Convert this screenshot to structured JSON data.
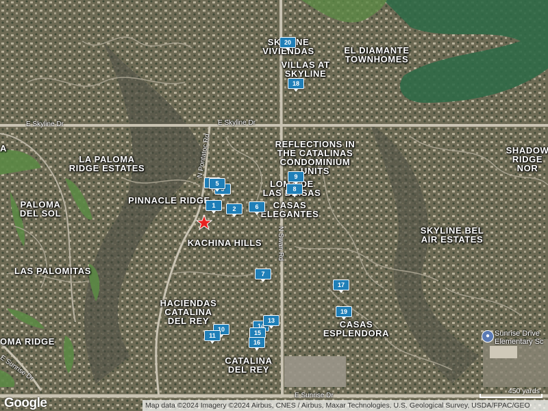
{
  "colors": {
    "terrain": "#6d6b55",
    "terrain_dark": "#4b4a3c",
    "golf_green": "#2f6a47",
    "grass": "#5b8a45",
    "road_major": "#c9c3b3",
    "marker_blue": "#1f7fb8",
    "star_red": "#e8201f"
  },
  "neighborhoods": [
    {
      "id": "skyline-viviendas",
      "label": "SKYLINE\nVIVIENDAS"
    },
    {
      "id": "el-diamante",
      "label": "EL DIAMANTE\nTOWNHOMES"
    },
    {
      "id": "villas-at-skyline",
      "label": "VILLAS AT\nSKYLINE"
    },
    {
      "id": "la-paloma-ridge",
      "label": "LA PALOMA\nRIDGE ESTATES"
    },
    {
      "id": "reflections",
      "label": "REFLECTIONS IN\nTHE CATALINAS\nCONDOMINIUM\nUNITS"
    },
    {
      "id": "shadow-ridge",
      "label": "SHADOW\nRIDGE NOR"
    },
    {
      "id": "loma-de-las-brisas",
      "label": "LOMA DE\nLAS BRISAS"
    },
    {
      "id": "pinnacle-ridge",
      "label": "PINNACLE RIDGE"
    },
    {
      "id": "paloma-del-sol",
      "label": "PALOMA\nDEL SOL"
    },
    {
      "id": "casas-elegantes",
      "label": "CASAS\nELEGANTES"
    },
    {
      "id": "skyline-bel-air",
      "label": "SKYLINE BEL\nAIR ESTATES"
    },
    {
      "id": "kachina-hills",
      "label": "KACHINA HILLS"
    },
    {
      "id": "las-palomitas",
      "label": "LAS PALOMITAS"
    },
    {
      "id": "haciendas",
      "label": "HACIENDAS\nCATALINA\nDEL REY"
    },
    {
      "id": "casas-esplendora",
      "label": "CASAS\nESPLENDORA"
    },
    {
      "id": "catalina-del-rey",
      "label": "CATALINA\nDEL REY"
    },
    {
      "id": "loma-ridge",
      "label": "OMA RIDGE"
    },
    {
      "id": "edge-a",
      "label": "A"
    }
  ],
  "streets": [
    {
      "id": "skyline-west",
      "label": "E Skyline Dr"
    },
    {
      "id": "skyline-east",
      "label": "E Skyline Dr"
    },
    {
      "id": "pontatoc",
      "label": "N Pontatoc Rd"
    },
    {
      "id": "swan",
      "label": "N Swan Rd"
    },
    {
      "id": "sunrise-east",
      "label": "E Sunrise Dr"
    },
    {
      "id": "sunrise-west",
      "label": "E Sunrise Dr"
    }
  ],
  "markers": [
    {
      "num": "20"
    },
    {
      "num": "18"
    },
    {
      "num": "9"
    },
    {
      "num": "8"
    },
    {
      "num": "5"
    },
    {
      "num": "4"
    },
    {
      "num": "3"
    },
    {
      "num": "1"
    },
    {
      "num": "2"
    },
    {
      "num": "6"
    },
    {
      "num": "7"
    },
    {
      "num": "17"
    },
    {
      "num": "19"
    },
    {
      "num": "13"
    },
    {
      "num": "14"
    },
    {
      "num": "15"
    },
    {
      "num": "16"
    },
    {
      "num": "10"
    },
    {
      "num": "11"
    }
  ],
  "school": {
    "label": "Sunrise Drive\nElementary Sc",
    "icon": "school-icon"
  },
  "google_logo": "Google",
  "attribution": "Map data ©2024 Imagery ©2024 Airbus, CNES / Airbus, Maxar Technologies, U.S. Geological Survey, USDA/FPAC/GEO",
  "scale_label": "450 yards",
  "selected_marker_icon": "star-icon"
}
